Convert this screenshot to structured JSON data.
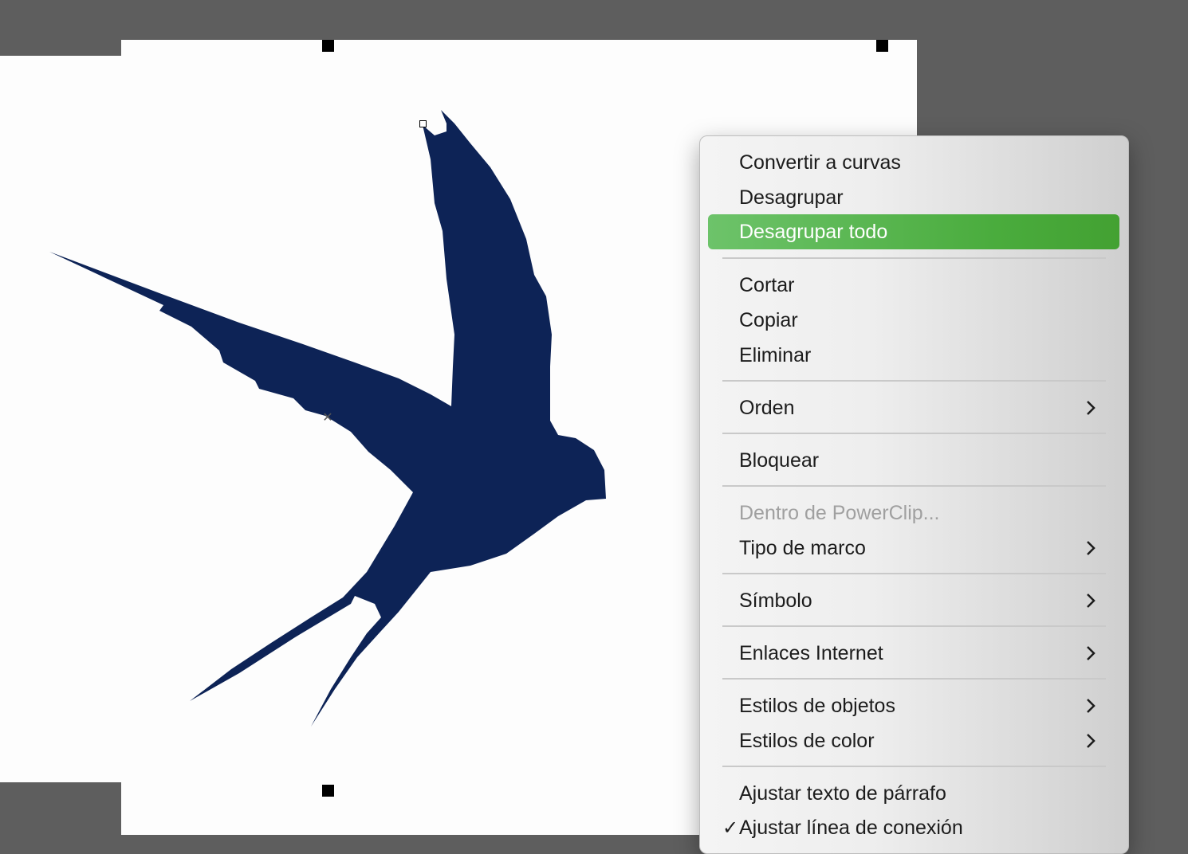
{
  "colors": {
    "bird_fill": "#0d2356",
    "workspace": "#5e5e5e",
    "page": "#fdfdfd",
    "highlight": "#4aac3d"
  },
  "menu": {
    "items": [
      {
        "label": "Convertir a curvas"
      },
      {
        "label": "Desagrupar"
      },
      {
        "label": "Desagrupar todo"
      },
      {
        "label": "Cortar"
      },
      {
        "label": "Copiar"
      },
      {
        "label": "Eliminar"
      },
      {
        "label": "Orden"
      },
      {
        "label": "Bloquear"
      },
      {
        "label": "Dentro de PowerClip..."
      },
      {
        "label": "Tipo de marco"
      },
      {
        "label": "Símbolo"
      },
      {
        "label": "Enlaces Internet"
      },
      {
        "label": "Estilos de objetos"
      },
      {
        "label": "Estilos de color"
      },
      {
        "label": "Ajustar texto de párrafo"
      },
      {
        "label": "Ajustar línea de conexión"
      }
    ],
    "check_mark": "✓"
  },
  "icons": {
    "submenu": "chevron-right-icon",
    "center": "center-x-icon"
  }
}
